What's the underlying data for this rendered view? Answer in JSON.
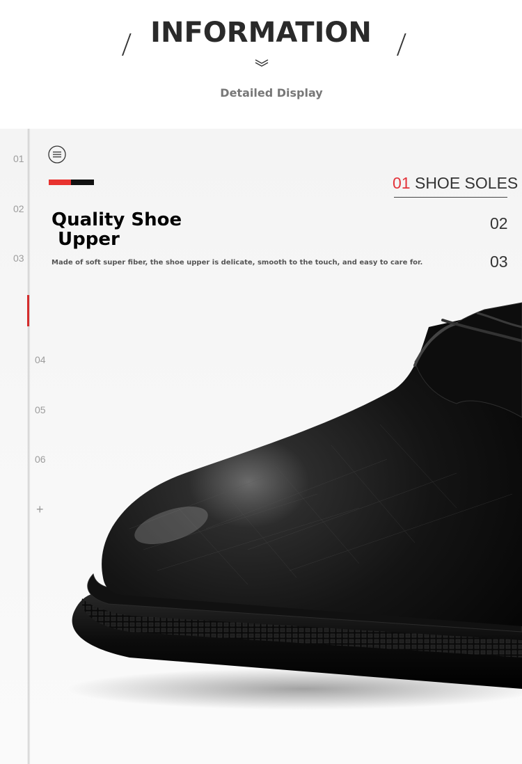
{
  "header": {
    "title": "INFORMATION",
    "subtitle": "Detailed Display"
  },
  "side_nav": {
    "items": [
      "01",
      "02",
      "03",
      "04",
      "05",
      "06"
    ],
    "more": "+"
  },
  "feature": {
    "heading_line1": "Quality Shoe",
    "heading_line2": "Upper",
    "description": "Made of soft super fiber, the shoe upper is delicate, smooth to the touch, and easy to care for."
  },
  "tabs": {
    "active_number": "01",
    "active_label": "SHOE SOLES",
    "items": [
      "02",
      "03"
    ]
  },
  "colors": {
    "accent_red": "#e3343b",
    "accent_black": "#111111",
    "background": "#f5f5f5"
  },
  "icons": {
    "menu": "menu-icon",
    "chevron": "double-chevron-down-icon"
  }
}
